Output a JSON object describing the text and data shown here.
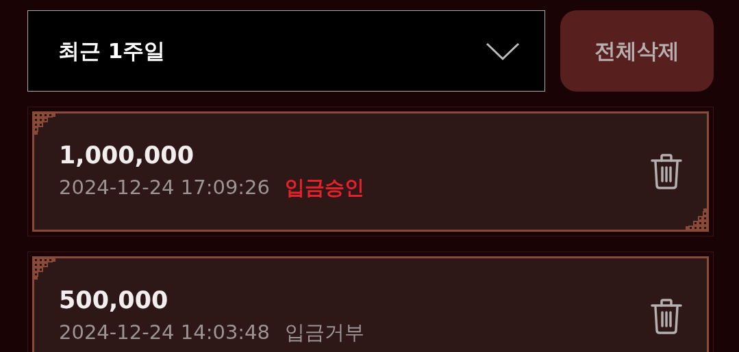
{
  "filter": {
    "value": "최근 1주일"
  },
  "delete_all_button": {
    "label": "전체삭제"
  },
  "records": [
    {
      "amount": "1,000,000",
      "datetime": "2024-12-24 17:09:26",
      "status": "입금승인",
      "approved": true
    },
    {
      "amount": "500,000",
      "datetime": "2024-12-24 14:03:48",
      "status": "입금거부",
      "approved": false
    }
  ]
}
